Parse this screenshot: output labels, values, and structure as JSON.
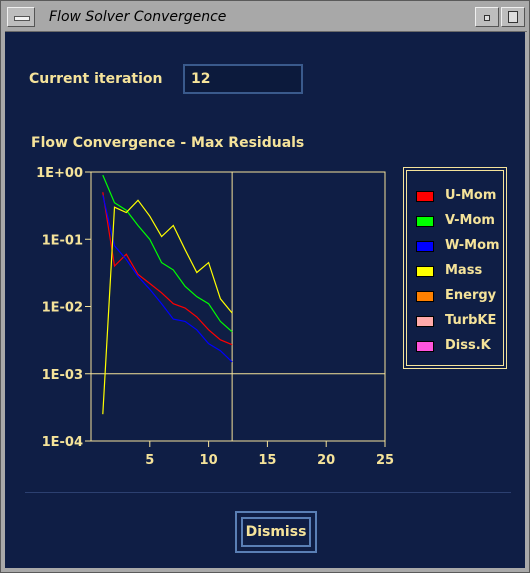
{
  "window": {
    "title": "Flow Solver Convergence"
  },
  "iteration": {
    "label": "Current iteration",
    "value": "12"
  },
  "chart_title": "Flow Convergence - Max Residuals",
  "dismiss_label": "Dismiss",
  "colors": {
    "background": "#0f1e45",
    "axis": "#f5e39a",
    "text": "#f5e39a"
  },
  "chart_data": {
    "type": "line",
    "title": "Flow Convergence - Max Residuals",
    "xlabel": "",
    "ylabel": "",
    "xlim": [
      0,
      25
    ],
    "ylim": [
      0.0001,
      1
    ],
    "yscale": "log",
    "xticks": [
      "5",
      "10",
      "15",
      "20",
      "25"
    ],
    "yticks": [
      "1E+00",
      "1E-01",
      "1E-02",
      "1E-03",
      "1E-04"
    ],
    "grid": "at current iteration and 1E-03",
    "legend": "right",
    "marker_x": 12,
    "x": [
      1,
      2,
      3,
      4,
      5,
      6,
      7,
      8,
      9,
      10,
      11,
      12
    ],
    "series": [
      {
        "name": "U-Mom",
        "color": "#ff0000",
        "values": [
          0.5,
          0.04,
          0.06,
          0.03,
          0.022,
          0.016,
          0.011,
          0.0095,
          0.007,
          0.0045,
          0.0032,
          0.0027
        ]
      },
      {
        "name": "V-Mom",
        "color": "#00ff00",
        "values": [
          0.9,
          0.35,
          0.27,
          0.16,
          0.1,
          0.045,
          0.035,
          0.02,
          0.014,
          0.011,
          0.006,
          0.0042
        ]
      },
      {
        "name": "W-Mom",
        "color": "#0000ff",
        "values": [
          0.45,
          0.08,
          0.05,
          0.028,
          0.018,
          0.011,
          0.0065,
          0.006,
          0.0045,
          0.0028,
          0.0022,
          0.0015
        ]
      },
      {
        "name": "Mass",
        "color": "#ffff00",
        "values": [
          0.00025,
          0.3,
          0.25,
          0.38,
          0.22,
          0.11,
          0.16,
          0.07,
          0.032,
          0.045,
          0.013,
          0.008
        ]
      },
      {
        "name": "Energy",
        "color": "#ff8000",
        "values": []
      },
      {
        "name": "TurbKE",
        "color": "#ffaaaa",
        "values": []
      },
      {
        "name": "Diss.K",
        "color": "#ff55dd",
        "values": []
      }
    ]
  }
}
